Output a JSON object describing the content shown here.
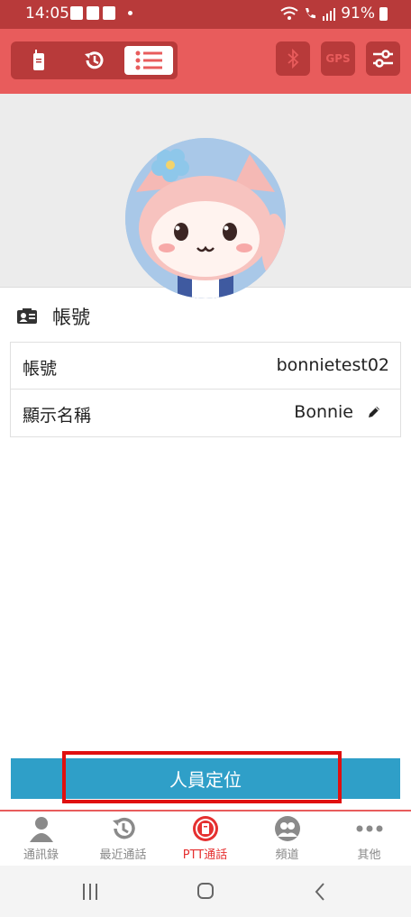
{
  "status_bar": {
    "time": "14:05",
    "battery": "91%"
  },
  "toolbar": {
    "segments": [
      "walkie-talkie",
      "history",
      "list"
    ],
    "gps_label": "GPS",
    "colors": {
      "bar": "#e85c5c",
      "dark": "#b83a3a"
    }
  },
  "account_section": {
    "title": "帳號",
    "rows": [
      {
        "key": "帳號",
        "value": "bonnietest02"
      },
      {
        "key": "顯示名稱",
        "value": "Bonnie"
      }
    ]
  },
  "locate_button": {
    "label": "人員定位",
    "color": "#2f9fc8"
  },
  "tabs": [
    {
      "label": "通訊錄",
      "icon": "contacts-icon"
    },
    {
      "label": "最近通話",
      "icon": "recent-calls-icon"
    },
    {
      "label": "PTT通話",
      "icon": "ptt-icon",
      "active": true
    },
    {
      "label": "頻道",
      "icon": "channel-icon"
    },
    {
      "label": "其他",
      "icon": "more-icon"
    }
  ]
}
